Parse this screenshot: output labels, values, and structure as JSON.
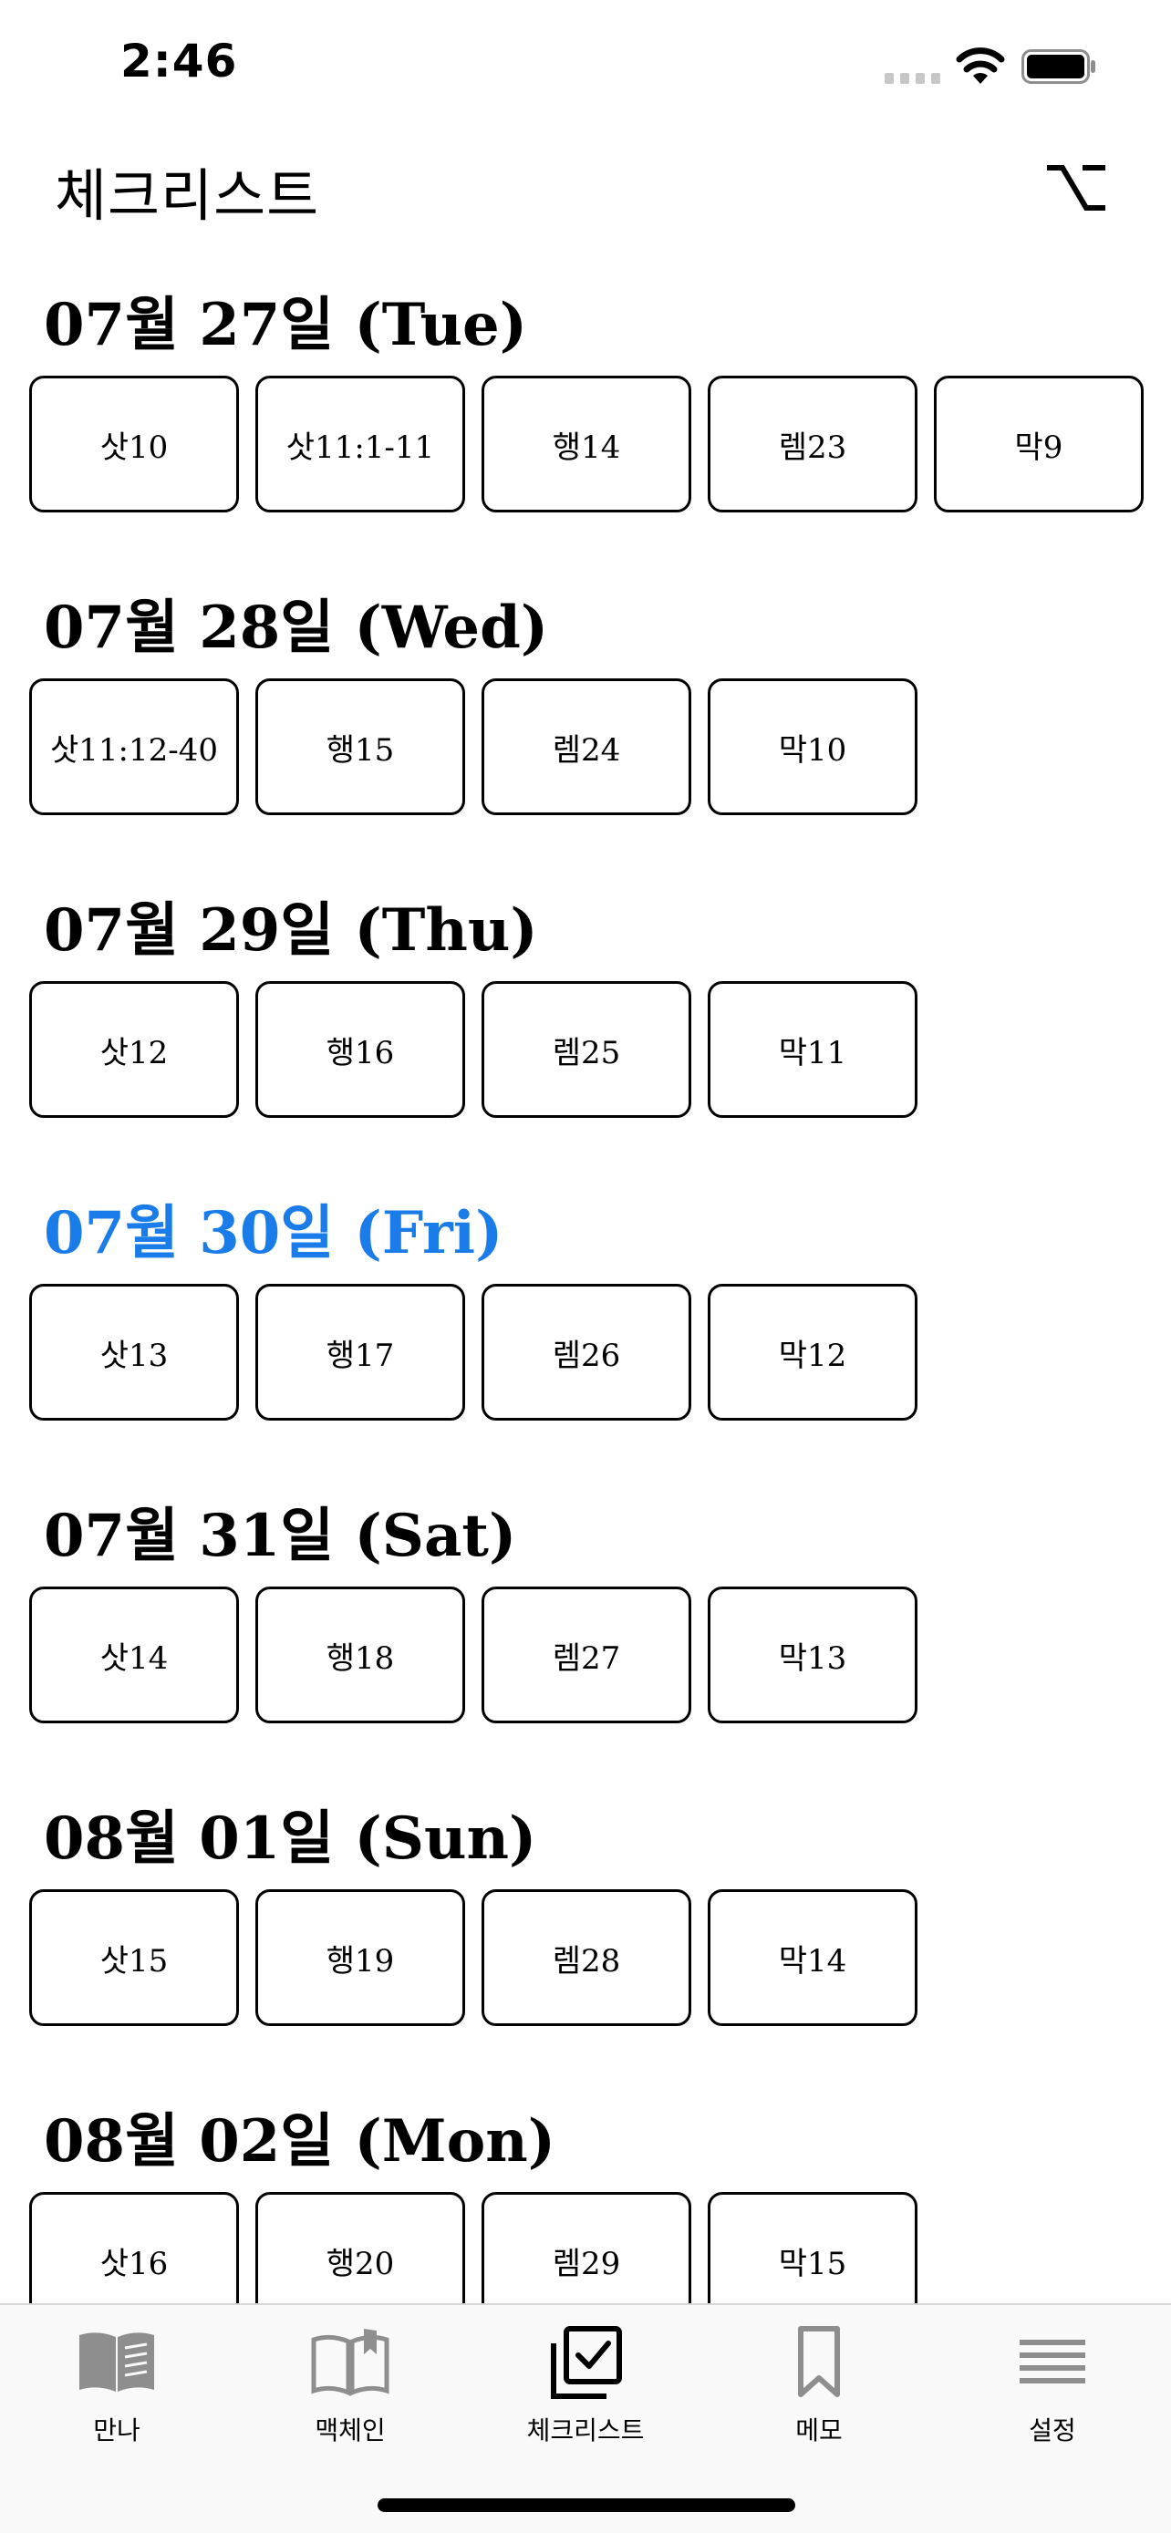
{
  "status": {
    "time": "2:46"
  },
  "nav": {
    "title": "체크리스트",
    "option_symbol": "⌥"
  },
  "colors": {
    "today": "#1a7ce8",
    "icon_gray": "#8e8e8e",
    "active": "#000000"
  },
  "days": [
    {
      "title": "07월 27일 (Tue)",
      "today": false,
      "readings": [
        "삿10",
        "삿11:1-11",
        "행14",
        "렘23",
        "막9"
      ]
    },
    {
      "title": "07월 28일 (Wed)",
      "today": false,
      "readings": [
        "삿11:12-40",
        "행15",
        "렘24",
        "막10"
      ]
    },
    {
      "title": "07월 29일 (Thu)",
      "today": false,
      "readings": [
        "삿12",
        "행16",
        "렘25",
        "막11"
      ]
    },
    {
      "title": "07월 30일 (Fri)",
      "today": true,
      "readings": [
        "삿13",
        "행17",
        "렘26",
        "막12"
      ]
    },
    {
      "title": "07월 31일 (Sat)",
      "today": false,
      "readings": [
        "삿14",
        "행18",
        "렘27",
        "막13"
      ]
    },
    {
      "title": "08월 01일 (Sun)",
      "today": false,
      "readings": [
        "삿15",
        "행19",
        "렘28",
        "막14"
      ]
    },
    {
      "title": "08월 02일 (Mon)",
      "today": false,
      "readings": [
        "삿16",
        "행20",
        "렘29",
        "막15"
      ]
    }
  ],
  "tabs": [
    {
      "label": "만나",
      "icon": "open-book-filled-icon",
      "active": false
    },
    {
      "label": "맥체인",
      "icon": "open-book-outline-icon",
      "active": false
    },
    {
      "label": "체크리스트",
      "icon": "checklist-icon",
      "active": true
    },
    {
      "label": "메모",
      "icon": "bookmark-icon",
      "active": false
    },
    {
      "label": "설정",
      "icon": "menu-lines-icon",
      "active": false
    }
  ]
}
